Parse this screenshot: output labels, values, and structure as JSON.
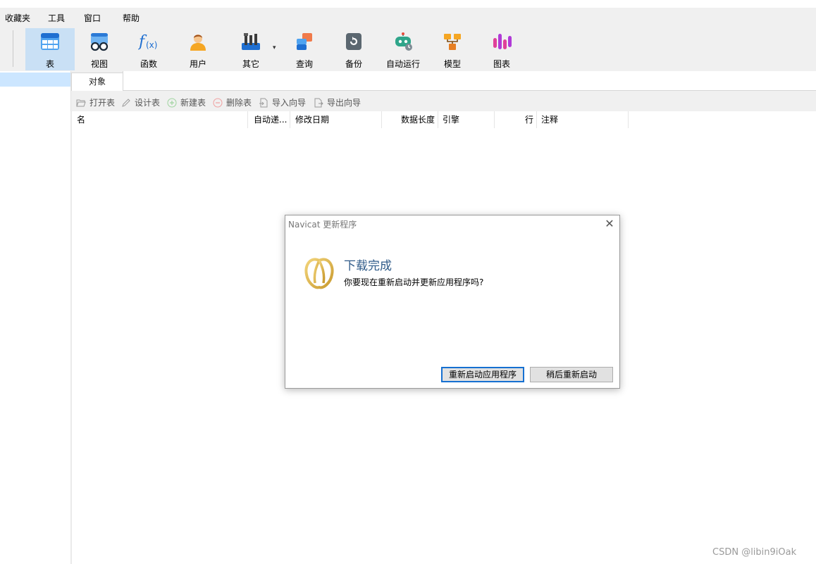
{
  "menubar": {
    "items": [
      "收藏夹",
      "工具",
      "窗口",
      "帮助"
    ]
  },
  "toolbar": {
    "buttons": [
      {
        "label": "表",
        "icon": "table-icon"
      },
      {
        "label": "视图",
        "icon": "view-icon"
      },
      {
        "label": "函数",
        "icon": "function-icon"
      },
      {
        "label": "用户",
        "icon": "user-icon"
      },
      {
        "label": "其它",
        "icon": "tools-icon"
      },
      {
        "label": "查询",
        "icon": "query-icon"
      },
      {
        "label": "备份",
        "icon": "backup-icon"
      },
      {
        "label": "自动运行",
        "icon": "robot-icon"
      },
      {
        "label": "模型",
        "icon": "model-icon"
      },
      {
        "label": "图表",
        "icon": "chart-icon"
      }
    ],
    "active": "表",
    "caret": "▾"
  },
  "tabs": {
    "objects": "对象"
  },
  "object_toolbar": {
    "open": "打开表",
    "design": "设计表",
    "new": "新建表",
    "delete": "删除表",
    "import": "导入向导",
    "export": "导出向导"
  },
  "columns": [
    "名",
    "自动递...",
    "修改日期",
    "数据长度",
    "引擎",
    "行",
    "注释"
  ],
  "dialog": {
    "title": "Navicat 更新程序",
    "close": "✕",
    "heading": "下载完成",
    "message": "你要现在重新启动并更新应用程序吗?",
    "primary_button": "重新启动应用程序",
    "secondary_button": "稍后重新启动"
  },
  "watermark": "CSDN @libin9iOak",
  "colors": {
    "accent": "#1670d1",
    "active_bg": "#c9e0f5",
    "heading": "#2f5b89",
    "logo": "#d9b44a"
  }
}
